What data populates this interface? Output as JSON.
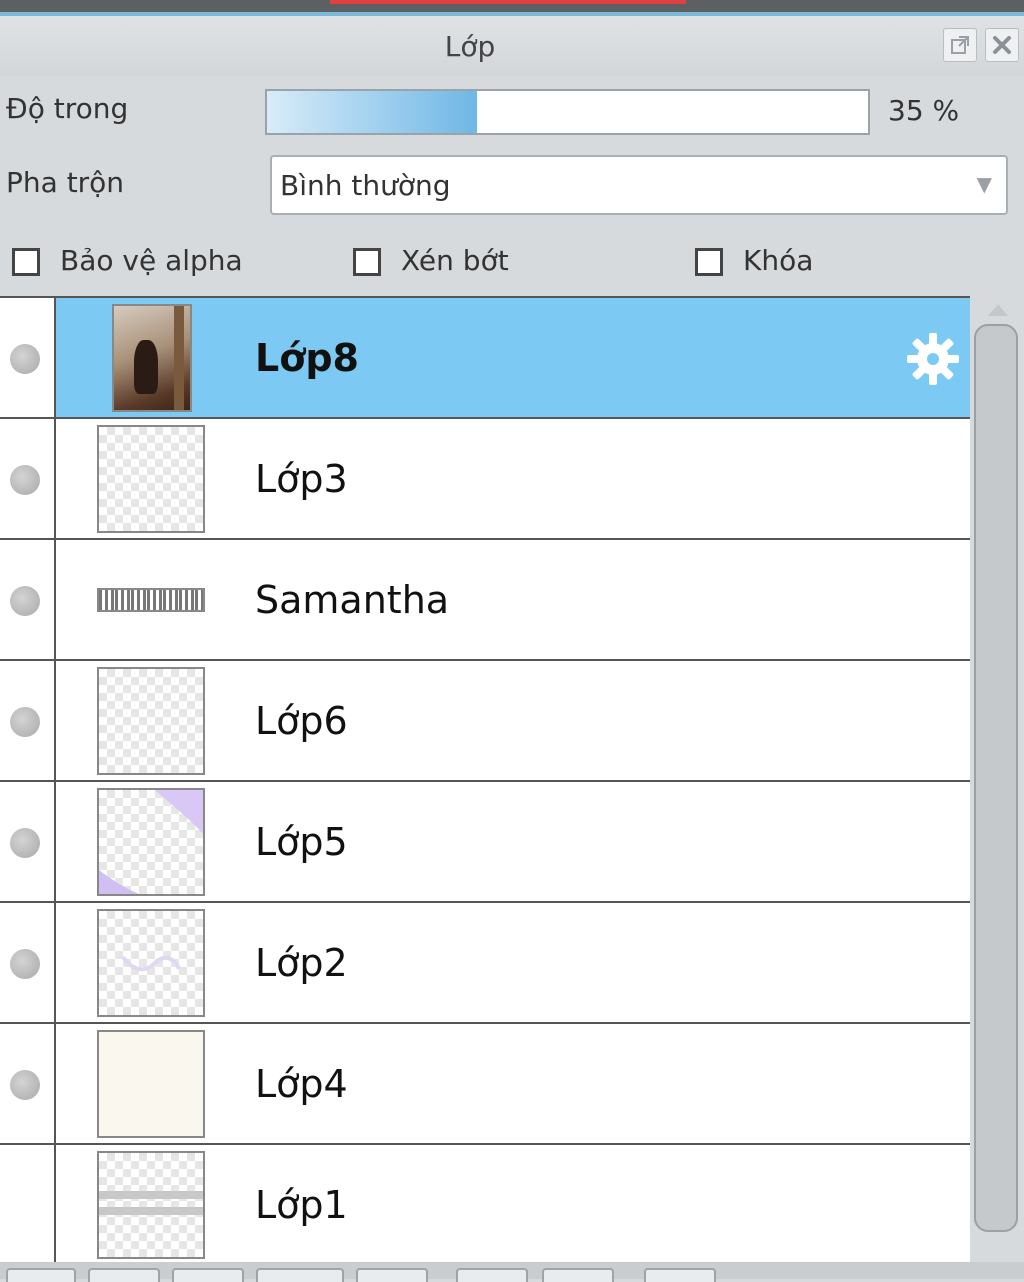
{
  "panel": {
    "title": "Lớp"
  },
  "opacity": {
    "label": "Độ trong",
    "value_text": "35 %",
    "value": 0.35
  },
  "blend": {
    "label": "Pha trộn",
    "selected": "Bình thường"
  },
  "options": {
    "protect_alpha": "Bảo vệ alpha",
    "clipping": "Xén bớt",
    "lock": "Khóa"
  },
  "layers": [
    {
      "name": "Lớp8",
      "selected": true,
      "thumbnail": "photo"
    },
    {
      "name": "Lớp3",
      "selected": false,
      "thumbnail": "transparent"
    },
    {
      "name": "Samantha",
      "selected": false,
      "thumbnail": "text-strip"
    },
    {
      "name": "Lớp6",
      "selected": false,
      "thumbnail": "transparent"
    },
    {
      "name": "Lớp5",
      "selected": false,
      "thumbnail": "lavender-corners"
    },
    {
      "name": "Lớp2",
      "selected": false,
      "thumbnail": "transparent"
    },
    {
      "name": "Lớp4",
      "selected": false,
      "thumbnail": "cream"
    },
    {
      "name": "Lớp1",
      "selected": false,
      "thumbnail": "gray-stripes"
    }
  ],
  "colors": {
    "selection": "#7ccaf4",
    "slider_fill": "#6fb7e6"
  }
}
